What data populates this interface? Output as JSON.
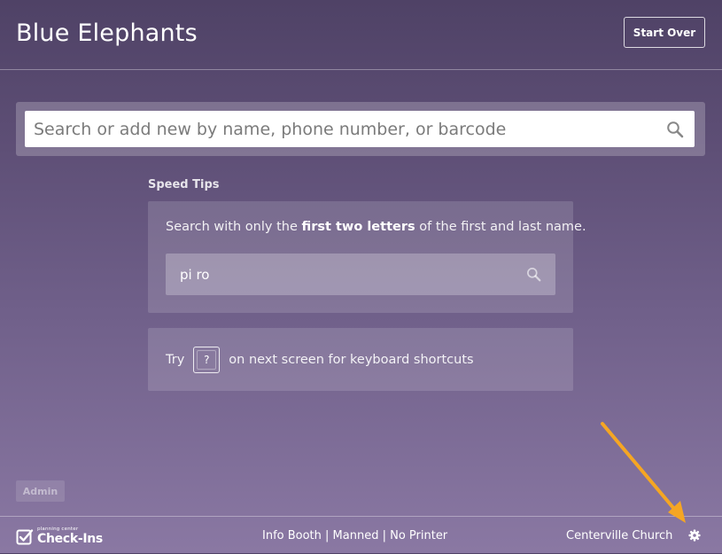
{
  "header": {
    "title": "Blue Elephants",
    "start_over_label": "Start Over"
  },
  "search": {
    "placeholder": "Search or add new by name, phone number, or barcode",
    "value": ""
  },
  "speed_tips": {
    "heading": "Speed Tips",
    "tip1_prefix": "Search with only the ",
    "tip1_bold": "first two letters",
    "tip1_suffix": " of the first and last name.",
    "example_query": "pi ro",
    "tip2_prefix": "Try",
    "tip2_key": "?",
    "tip2_suffix": "on next screen for keyboard shortcuts"
  },
  "admin": {
    "label": "Admin"
  },
  "footer": {
    "logo_small": "planning center",
    "logo_big": "Check-Ins",
    "status": "Info Booth | Manned | No Printer",
    "church": "Centerville Church"
  },
  "colors": {
    "accent_arrow": "#f5a623"
  }
}
